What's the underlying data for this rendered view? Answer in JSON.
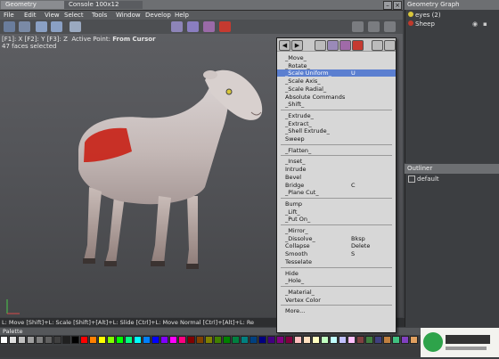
{
  "tabs": {
    "geometry": "Geometry",
    "console": "Console 100x12"
  },
  "menubar": [
    "File",
    "Edit",
    "View",
    "Select",
    "Tools",
    "Window",
    "Develop",
    "Help"
  ],
  "viewport": {
    "line1_keys": "[F1]: X  [F2]: Y  [F3]: Z",
    "line1_label": "Active Point:",
    "line1_value": "From Cursor",
    "line2": "47 faces selected"
  },
  "statusbar": "L: Move  [Shift]+L: Scale  [Shift]+[Alt]+L: Slide  [Ctrl]+L: Move Normal  [Ctrl]+[Alt]+L: Re",
  "palette_label": "Palette",
  "context_menu": {
    "groups": [
      [
        {
          "label": "_Move_",
          "shortcut": ""
        },
        {
          "label": "_Rotate_",
          "shortcut": ""
        },
        {
          "label": "_Scale Uniform_",
          "shortcut": "U",
          "highlighted": true
        },
        {
          "label": "_Scale Axis_",
          "shortcut": ""
        },
        {
          "label": "_Scale Radial_",
          "shortcut": ""
        },
        {
          "label": "Absolute Commands",
          "shortcut": ""
        },
        {
          "label": "_Shift_",
          "shortcut": ""
        }
      ],
      [
        {
          "label": "_Extrude_",
          "shortcut": ""
        },
        {
          "label": "_Extract_",
          "shortcut": ""
        },
        {
          "label": "_Shell Extrude_",
          "shortcut": ""
        },
        {
          "label": "Sweep",
          "shortcut": ""
        }
      ],
      [
        {
          "label": "_Flatten_",
          "shortcut": ""
        }
      ],
      [
        {
          "label": "_Inset_",
          "shortcut": ""
        },
        {
          "label": "Intrude",
          "shortcut": ""
        },
        {
          "label": "Bevel",
          "shortcut": ""
        },
        {
          "label": "Bridge",
          "shortcut": "C"
        },
        {
          "label": "_Plane Cut_",
          "shortcut": ""
        }
      ],
      [
        {
          "label": "Bump",
          "shortcut": ""
        },
        {
          "label": "_Lift_",
          "shortcut": ""
        },
        {
          "label": "_Put On_",
          "shortcut": ""
        }
      ],
      [
        {
          "label": "_Mirror_",
          "shortcut": ""
        },
        {
          "label": "_Dissolve_",
          "shortcut": "Bksp"
        },
        {
          "label": "Collapse",
          "shortcut": "Delete"
        },
        {
          "label": "Smooth",
          "shortcut": "S"
        },
        {
          "label": "Tesselate",
          "shortcut": ""
        }
      ],
      [
        {
          "label": "Hide",
          "shortcut": ""
        },
        {
          "label": "_Hole_",
          "shortcut": ""
        }
      ],
      [
        {
          "label": "_Material_",
          "shortcut": ""
        },
        {
          "label": "Vertex Color",
          "shortcut": ""
        }
      ],
      [
        {
          "label": "More...",
          "shortcut": ""
        }
      ]
    ]
  },
  "geometry_graph": {
    "title": "Geometry Graph",
    "items": [
      {
        "label": "eyes (2)",
        "color": "#d8c63a"
      },
      {
        "label": "Sheep",
        "color": "#c0392b"
      }
    ]
  },
  "outliner": {
    "title": "Outliner",
    "items": [
      "default"
    ]
  },
  "colors": {
    "selection_red": "#c8281e",
    "highlight": "#5b7fd0"
  }
}
